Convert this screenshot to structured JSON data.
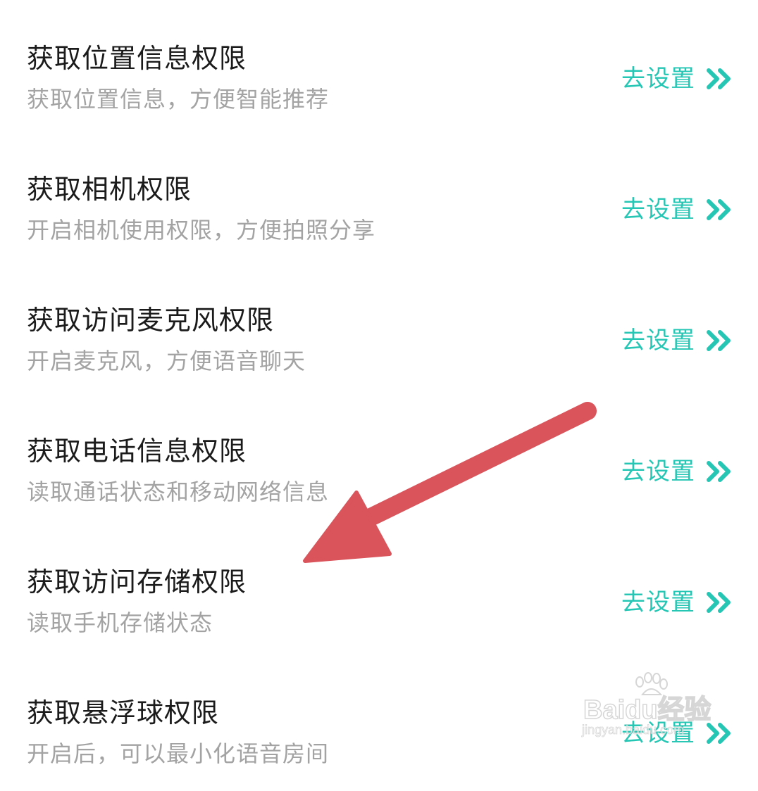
{
  "permissions": [
    {
      "title": "获取位置信息权限",
      "desc": "获取位置信息，方便智能推荐",
      "action": "去设置"
    },
    {
      "title": "获取相机权限",
      "desc": "开启相机使用权限，方便拍照分享",
      "action": "去设置"
    },
    {
      "title": "获取访问麦克风权限",
      "desc": "开启麦克风，方便语音聊天",
      "action": "去设置"
    },
    {
      "title": "获取电话信息权限",
      "desc": "读取通话状态和移动网络信息",
      "action": "去设置"
    },
    {
      "title": "获取访问存储权限",
      "desc": "读取手机存储状态",
      "action": "去设置"
    },
    {
      "title": "获取悬浮球权限",
      "desc": "开启后，可以最小化语音房间",
      "action": "去设置"
    }
  ],
  "action_icon": "double-chevron-right-icon",
  "colors": {
    "title": "#1b1b1b",
    "desc": "#a3a3a3",
    "accent": "#25c6b4",
    "arrow": "#d9545b"
  },
  "watermark": {
    "brand": "Baidu经验",
    "url": "jingyan.baidu.com"
  }
}
